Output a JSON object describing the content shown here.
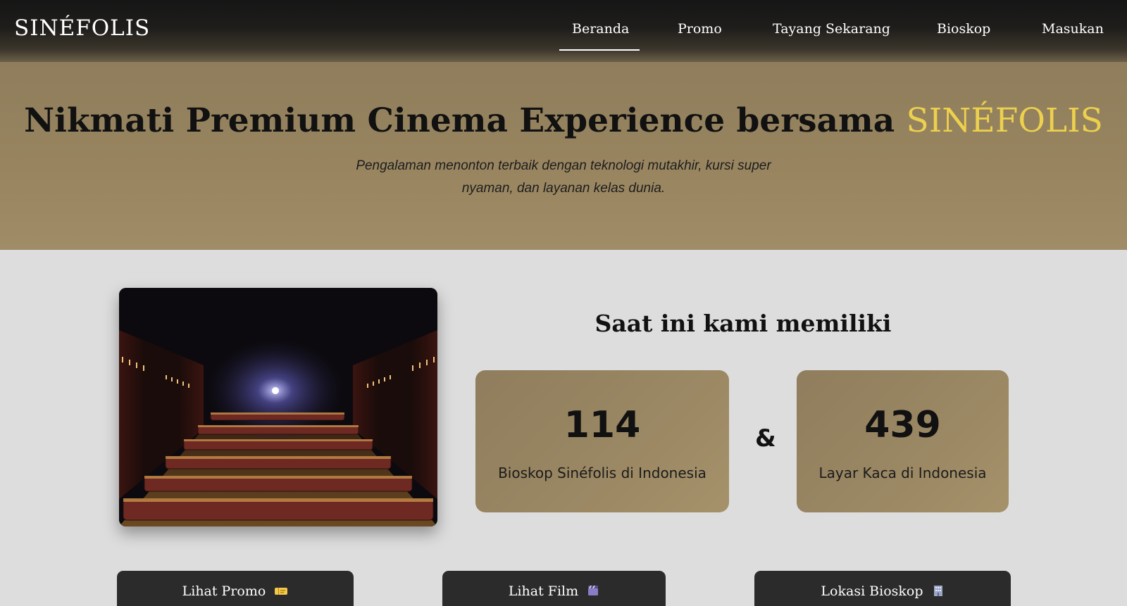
{
  "header": {
    "logo": "SINÉFOLIS",
    "nav": [
      {
        "label": "Beranda",
        "active": true
      },
      {
        "label": "Promo",
        "active": false
      },
      {
        "label": "Tayang Sekarang",
        "active": false
      },
      {
        "label": "Bioskop",
        "active": false
      },
      {
        "label": "Masukan",
        "active": false
      }
    ]
  },
  "hero": {
    "title_main": "Nikmati Premium Cinema Experience bersama",
    "title_brand": "SINÉFOLIS",
    "subtitle_line1": "Pengalaman menonton terbaik dengan teknologi mutakhir, kursi super",
    "subtitle_line2": "nyaman, dan layanan kelas dunia."
  },
  "stats": {
    "heading": "Saat ini kami memiliki",
    "cinemas": {
      "number": "114",
      "label": "Bioskop Sinéfolis di Indonesia"
    },
    "connector": "&",
    "screens": {
      "number": "439",
      "label": "Layar Kaca di Indonesia"
    }
  },
  "actions": [
    {
      "label": "Lihat Promo",
      "icon": "ticket-icon"
    },
    {
      "label": "Lihat Film",
      "icon": "clapperboard-icon"
    },
    {
      "label": "Lokasi Bioskop",
      "icon": "building-icon"
    }
  ],
  "colors": {
    "accent_gold": "#ecd04e",
    "hero_bg": "#97845f",
    "card_bg": "#9a8763",
    "button_bg": "#2b2b2b"
  }
}
